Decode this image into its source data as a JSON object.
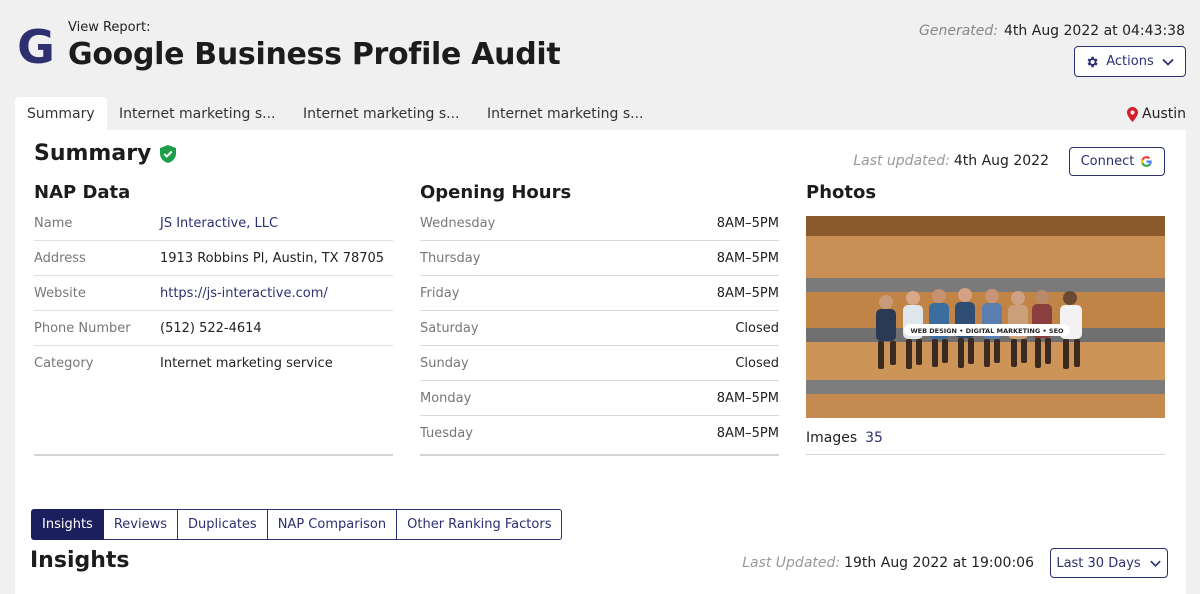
{
  "header": {
    "view_report": "View Report:",
    "title": "Google Business Profile Audit",
    "generated_label": "Generated:",
    "generated_value": "4th Aug 2022 at 04:43:38",
    "actions_label": "Actions",
    "logo_letter": "G",
    "brand_color": "#2d3070"
  },
  "tabs": [
    {
      "label": "Summary",
      "active": true
    },
    {
      "label": "Internet marketing s..."
    },
    {
      "label": "Internet marketing s..."
    },
    {
      "label": "Internet marketing s..."
    }
  ],
  "location": {
    "label": "Austin",
    "icon": "map-pin-icon"
  },
  "summary": {
    "title": "Summary",
    "verified_icon": "shield-check-icon",
    "last_updated_label": "Last updated:",
    "last_updated_value": "4th Aug 2022",
    "connect_label": "Connect",
    "nap": {
      "title": "NAP Data",
      "rows": [
        {
          "key": "Name",
          "value": "JS Interactive, LLC",
          "link": true
        },
        {
          "key": "Address",
          "value": "1913 Robbins Pl, Austin, TX 78705"
        },
        {
          "key": "Website",
          "value": "https://js-interactive.com/",
          "link": true
        },
        {
          "key": "Phone Number",
          "value": "(512) 522-4614"
        },
        {
          "key": "Category",
          "value": "Internet marketing service"
        }
      ]
    },
    "hours": {
      "title": "Opening Hours",
      "rows": [
        {
          "day": "Wednesday",
          "time": "8AM–5PM"
        },
        {
          "day": "Thursday",
          "time": "8AM–5PM"
        },
        {
          "day": "Friday",
          "time": "8AM–5PM"
        },
        {
          "day": "Saturday",
          "time": "Closed"
        },
        {
          "day": "Sunday",
          "time": "Closed"
        },
        {
          "day": "Monday",
          "time": "8AM–5PM"
        },
        {
          "day": "Tuesday",
          "time": "8AM–5PM"
        }
      ]
    },
    "photos": {
      "title": "Photos",
      "banner_text": "WEB DESIGN • DIGITAL MARKETING • SEO",
      "images_label": "Images",
      "images_count": "35"
    }
  },
  "subtabs": [
    {
      "label": "Insights",
      "active": true
    },
    {
      "label": "Reviews"
    },
    {
      "label": "Duplicates"
    },
    {
      "label": "NAP Comparison"
    },
    {
      "label": "Other Ranking Factors"
    }
  ],
  "insights": {
    "title": "Insights",
    "last_updated_label": "Last Updated:",
    "last_updated_value": "19th Aug 2022 at 19:00:06",
    "range_label": "Last 30 Days"
  }
}
